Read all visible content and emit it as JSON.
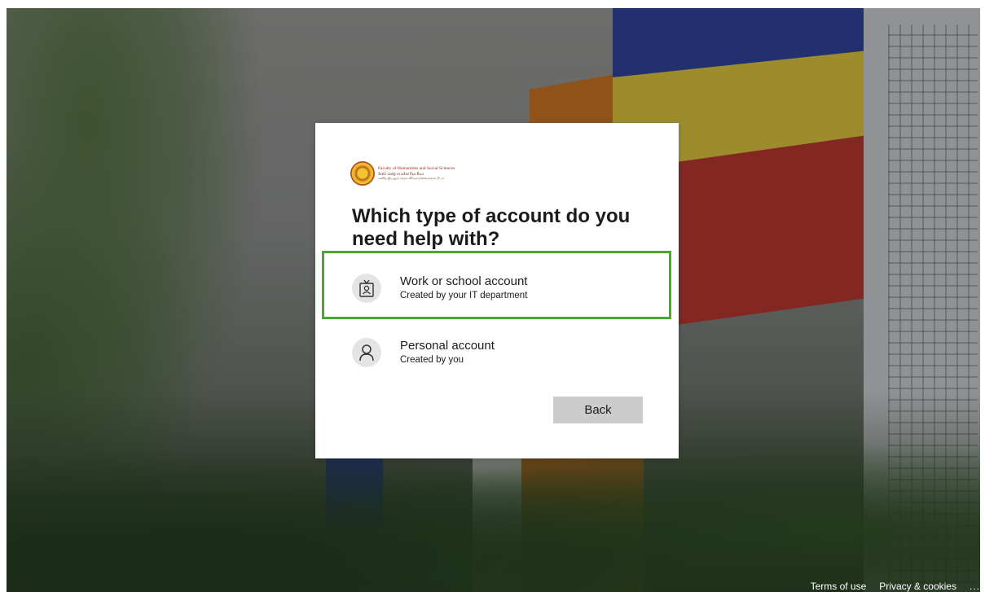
{
  "dialog": {
    "logo": {
      "line1": "Faculty of Humanities and Social Sciences",
      "line2": "මානව ශාස්ත්‍ර හා සමාජ විද්‍යා පීඨය",
      "line3": "மனித இயலும் சமூக விஞ்ஞானங்களும் பீடம்"
    },
    "title": "Which type of account do you need help with?",
    "options": [
      {
        "title": "Work or school account",
        "subtitle": "Created by your IT department",
        "icon": "badge-icon"
      },
      {
        "title": "Personal account",
        "subtitle": "Created by you",
        "icon": "person-icon"
      }
    ],
    "back_label": "Back"
  },
  "footer": {
    "terms": "Terms of use",
    "privacy": "Privacy & cookies",
    "more": "..."
  },
  "colors": {
    "highlight": "#4aa832",
    "button_bg": "#cccccc"
  }
}
